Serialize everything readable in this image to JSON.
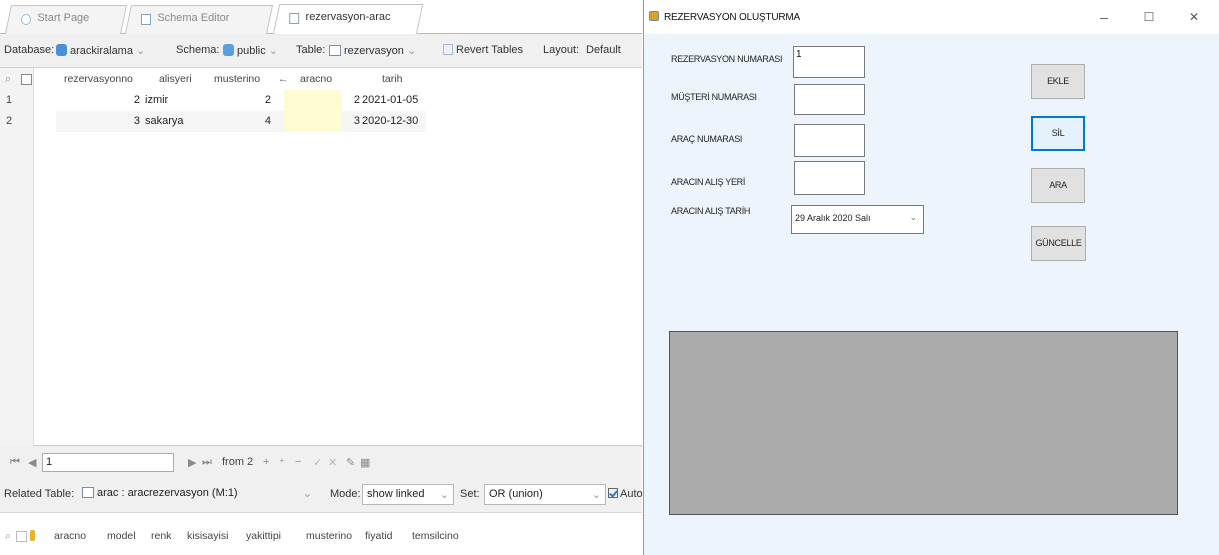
{
  "left_app": {
    "tabs": [
      {
        "label": "Start Page"
      },
      {
        "label": "Schema Editor"
      },
      {
        "label": "rezervasyon-arac"
      }
    ],
    "toolbar": {
      "database_label": "Database:",
      "database_value": "arackiralama",
      "schema_label": "Schema:",
      "schema_value": "public",
      "table_label": "Table:",
      "table_value": "rezervasyon",
      "revert_label": "Revert Tables",
      "layout_label": "Layout:",
      "layout_value": "Default",
      "dd_arrow": "⌄"
    },
    "grid": {
      "columns": [
        "rezervasyonno",
        "alisyeri",
        "musterino",
        "aracno",
        "tarih"
      ],
      "fk_marker": "←",
      "rows": [
        {
          "rownum": "1",
          "rezervasyonno": "2",
          "alisyeri": "izmir",
          "musterino": "2",
          "aracno": "2",
          "tarih": "2021-01-05"
        },
        {
          "rownum": "2",
          "rezervasyonno": "3",
          "alisyeri": "sakarya",
          "musterino": "4",
          "aracno": "3",
          "tarih": "2020-12-30"
        }
      ]
    },
    "navigator": {
      "first": "⏮",
      "prev": "◀",
      "page_value": "1",
      "next": "▶",
      "last": "⏭",
      "from_text": "from 2",
      "add": "+",
      "dup": "⁺",
      "minus": "−",
      "confirm": "✓",
      "cancel": "✕",
      "edit": "✎",
      "grid_icon": "▦"
    },
    "related": {
      "label": "Related Table:",
      "value": "arac : aracrezervasyon (M:1)",
      "mode_label": "Mode:",
      "mode_value": "show linked",
      "set_label": "Set:",
      "set_value": "OR (union)",
      "auto_label": "Auto",
      "columns": [
        "aracno",
        "model",
        "renk",
        "kisisayisi",
        "yakittipi",
        "musterino",
        "fiyatid",
        "temsilcino"
      ]
    }
  },
  "right_window": {
    "title": "REZERVASYON OLUŞTURMA",
    "controls": {
      "minimize": "–",
      "maximize": "☐",
      "close": "✕"
    },
    "fields": {
      "rez_no_label": "REZERVASYON NUMARASI",
      "rez_no_value": "1",
      "musteri_label": "MÜŞTERİ NUMARASI",
      "musteri_value": "",
      "arac_label": "ARAÇ NUMARASI",
      "arac_value": "",
      "alis_yeri_label": "ARACIN ALIŞ YERİ",
      "alis_yeri_value": "",
      "alis_tarih_label": "ARACIN ALIŞ TARİH",
      "alis_tarih_value": "29   Aralık   2020     Salı",
      "dtp_arrow": "⌄"
    },
    "buttons": {
      "ekle": "EKLE",
      "sil": "SİL",
      "ara": "ARA",
      "guncelle": "GÜNCELLE"
    }
  }
}
